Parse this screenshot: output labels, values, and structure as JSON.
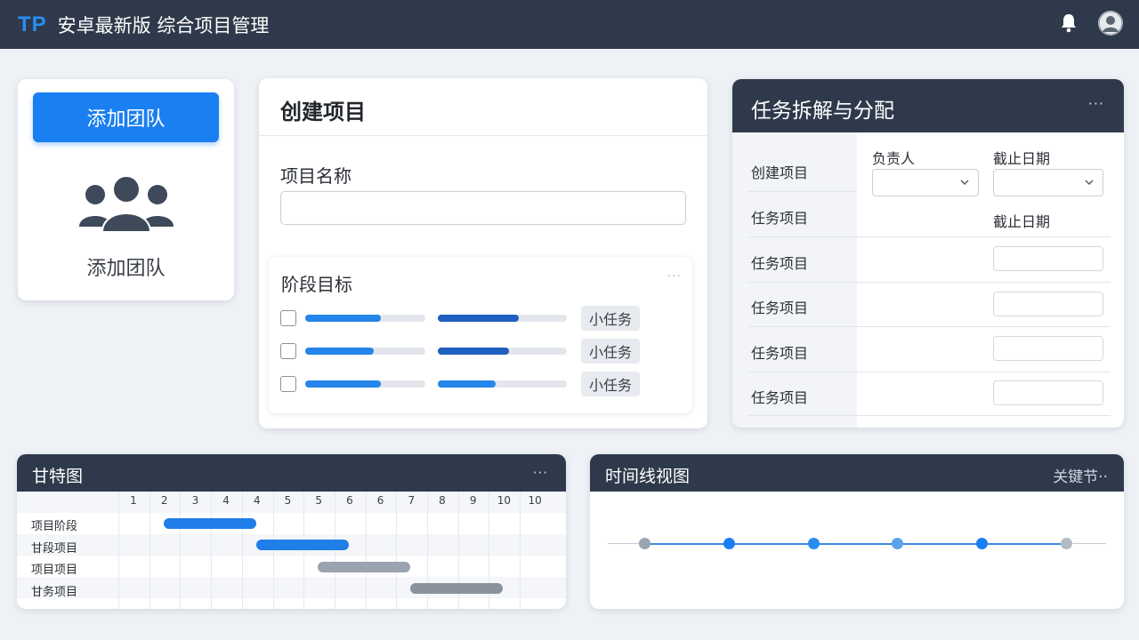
{
  "header": {
    "logo": "TP",
    "title": "安卓最新版 综合项目管理"
  },
  "team": {
    "button_label": "添加团队",
    "label": "添加团队"
  },
  "create_project": {
    "title": "创建项目",
    "name_label": "项目名称",
    "name_value": "",
    "stage": {
      "title": "阶段目标",
      "more": "···",
      "rows": [
        {
          "checked": false,
          "bar1": 0.63,
          "bar2": 0.63,
          "tag": "小任务"
        },
        {
          "checked": false,
          "bar1": 0.57,
          "bar2": 0.55,
          "tag": "小任务"
        },
        {
          "checked": false,
          "bar1": 0.63,
          "bar2": 0.45,
          "tag": "小任务"
        }
      ]
    }
  },
  "task_split": {
    "title": "任务拆解与分配",
    "more": "···",
    "col_owner": "负责人",
    "col_due": "截止日期",
    "col_due2": "截止日期",
    "rows": [
      "创建项目",
      "任务项目",
      "任务项目",
      "任务项目",
      "任务项目",
      "任务项目"
    ]
  },
  "gantt": {
    "title": "甘特图",
    "more": "···",
    "days": [
      "1",
      "2",
      "3",
      "4",
      "4",
      "5",
      "5",
      "6",
      "6",
      "7",
      "8",
      "9",
      "10",
      "10"
    ],
    "tasks": [
      {
        "label": "项目阶段",
        "start": 1,
        "span": 3,
        "track_end": 4,
        "color": "#1f7ee8"
      },
      {
        "label": "甘段项目",
        "start": 4,
        "span": 3,
        "track_end": 7,
        "color": "#1f7ee8"
      },
      {
        "label": "项目项目",
        "start": 6,
        "span": 3,
        "track_end": 9,
        "color": "#9aa3ae"
      },
      {
        "label": "甘务项目",
        "start": 9,
        "span": 3,
        "track_end": 12,
        "color": "#8a929c"
      }
    ]
  },
  "timeline": {
    "title": "时间线视图",
    "right_label": "关键节··",
    "nodes": [
      {
        "color": "#9aa3ae"
      },
      {
        "color": "#1a7ff0"
      },
      {
        "color": "#2a8cf0"
      },
      {
        "color": "#5aa2ec"
      },
      {
        "color": "#1a7ff0"
      },
      {
        "color": "#b3bac3"
      }
    ]
  },
  "colors": {
    "header_bg": "#2e3a4b",
    "accent": "#1a7ff0",
    "accent_dark": "#1f5fc0"
  }
}
